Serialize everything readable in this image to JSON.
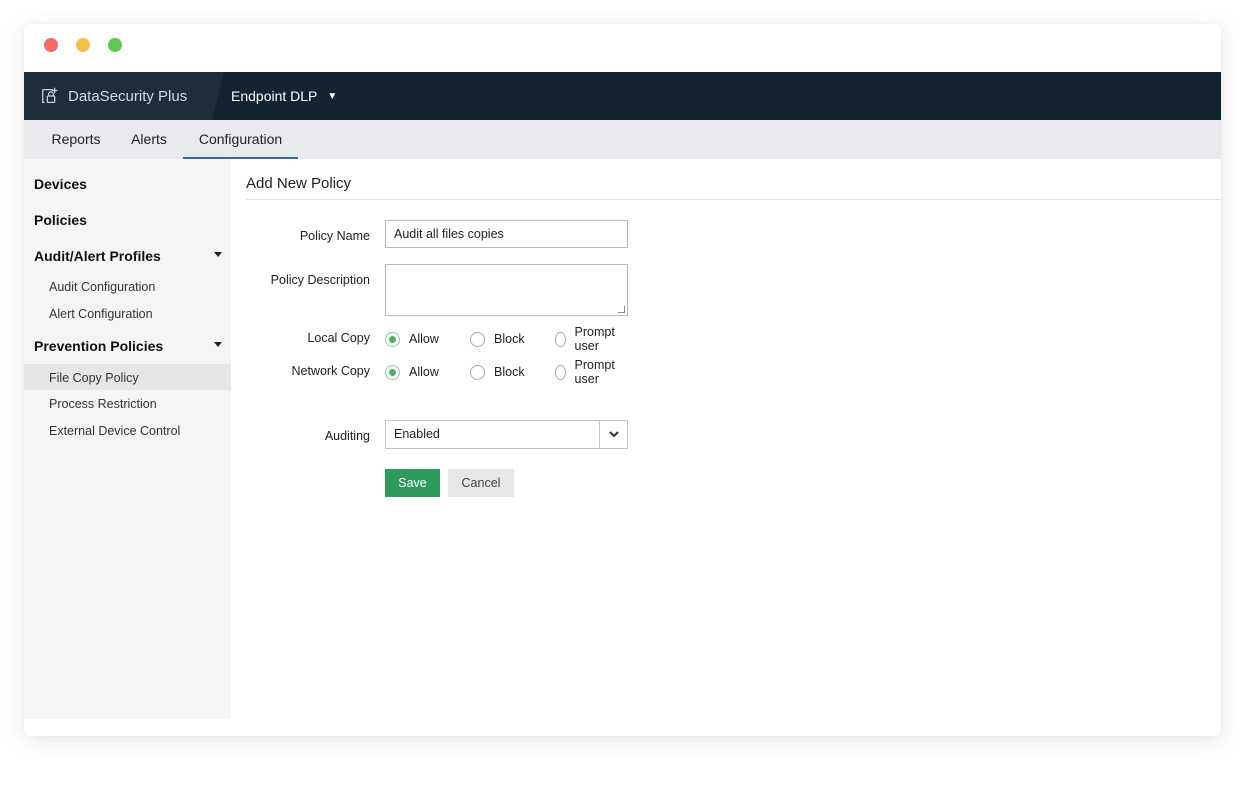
{
  "window": {
    "controls": [
      "close",
      "minimize",
      "maximize"
    ]
  },
  "header": {
    "brand": "DataSecurity Plus",
    "brand_icon": "lock-shield-icon",
    "product": "Endpoint DLP",
    "product_caret": "▼"
  },
  "tabs": [
    {
      "label": "Reports",
      "active": false
    },
    {
      "label": "Alerts",
      "active": false
    },
    {
      "label": "Configuration",
      "active": true
    }
  ],
  "sidebar": {
    "devices": "Devices",
    "policies": "Policies",
    "audit_alert_profiles": "Audit/Alert Profiles",
    "audit_configuration": "Audit Configuration",
    "alert_configuration": "Alert Configuration",
    "prevention_policies": "Prevention Policies",
    "file_copy_policy": "File Copy Policy",
    "process_restriction": "Process Restriction",
    "external_device_control": "External Device Control",
    "active_item": "File Copy Policy"
  },
  "form": {
    "title": "Add New Policy",
    "policy_name_label": "Policy Name",
    "policy_name_value": "Audit all files copies",
    "policy_description_label": "Policy Description",
    "policy_description_value": "",
    "local_copy_label": "Local Copy",
    "network_copy_label": "Network Copy",
    "options": {
      "allow": "Allow",
      "block": "Block",
      "prompt": "Prompt user"
    },
    "local_copy_selected": "Allow",
    "network_copy_selected": "Allow",
    "auditing_label": "Auditing",
    "auditing_value": "Enabled",
    "save_label": "Save",
    "cancel_label": "Cancel"
  },
  "colors": {
    "appbar": "#13232f",
    "brand_panel": "#1d2e3a",
    "tab_underline": "#2f6ab0",
    "save_button": "#2e9a5c",
    "radio_selected": "#4caf64"
  }
}
